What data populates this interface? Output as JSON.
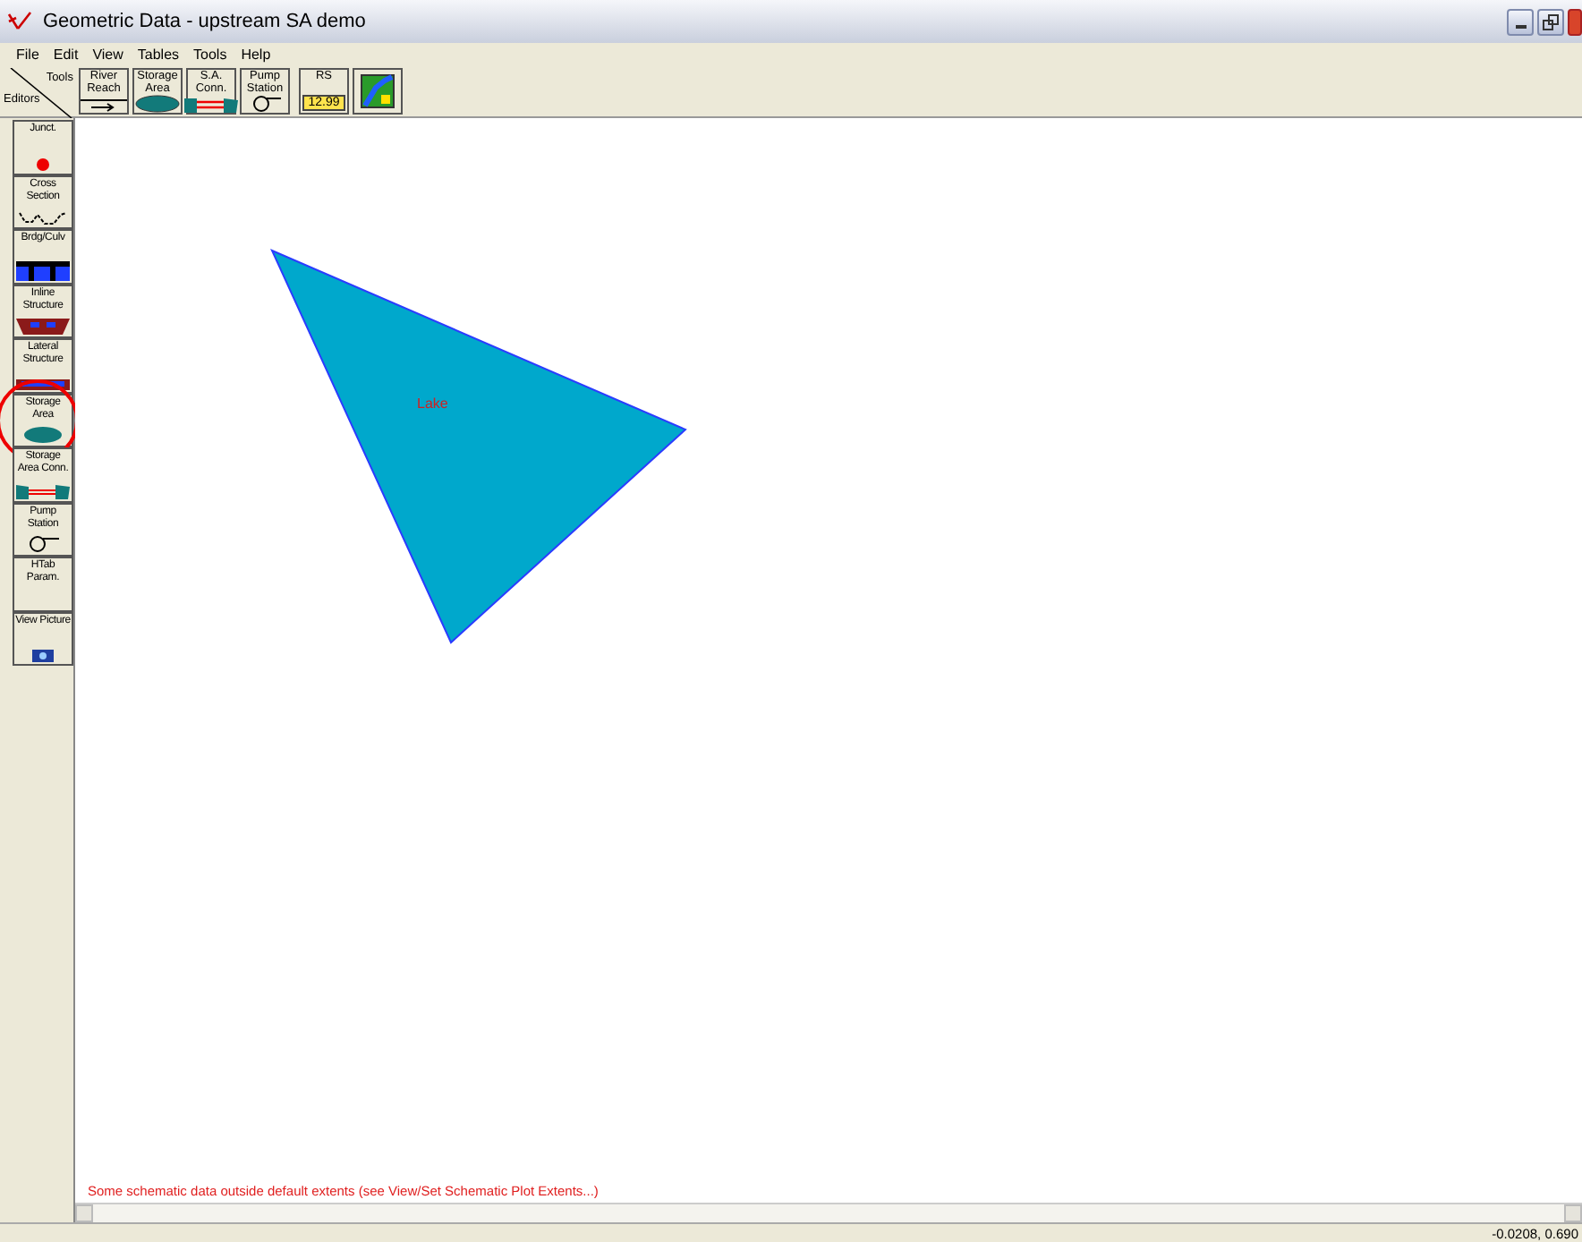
{
  "window": {
    "title": "Geometric Data - upstream SA demo"
  },
  "menu": [
    "File",
    "Edit",
    "View",
    "Tables",
    "Tools",
    "Help"
  ],
  "toolbar": {
    "corner_top": "Tools",
    "corner_bottom": "Editors",
    "tools": [
      {
        "kind": "reach",
        "label": "River Reach"
      },
      {
        "kind": "storage",
        "label": "Storage Area"
      },
      {
        "kind": "conn",
        "label": "S.A. Conn."
      },
      {
        "kind": "pump",
        "label": "Pump Station"
      },
      {
        "kind": "rs",
        "label": "RS",
        "value": "12.99"
      },
      {
        "kind": "map"
      }
    ]
  },
  "editors": [
    {
      "kind": "junct",
      "label": "Junct.",
      "circled": false
    },
    {
      "kind": "xs",
      "label": "Cross Section",
      "circled": false
    },
    {
      "kind": "bridge",
      "label": "Brdg/Culv",
      "circled": false
    },
    {
      "kind": "inline",
      "label": "Inline Structure",
      "circled": false
    },
    {
      "kind": "lateral",
      "label": "Lateral Structure",
      "circled": false
    },
    {
      "kind": "storage",
      "label": "Storage Area",
      "circled": true
    },
    {
      "kind": "conn",
      "label": "Storage Area Conn.",
      "circled": false
    },
    {
      "kind": "pump",
      "label": "Pump Station",
      "circled": false
    },
    {
      "kind": "htab",
      "label": "HTab Param.",
      "circled": false
    },
    {
      "kind": "picture",
      "label": "View Picture",
      "circled": false
    }
  ],
  "schematic": {
    "storage_areas": [
      {
        "name": "Lake"
      }
    ],
    "message": "Some schematic data outside default extents (see View/Set Schematic Plot Extents...)"
  },
  "status_bar": {
    "coordinates": "-0.0208, 0.690"
  }
}
